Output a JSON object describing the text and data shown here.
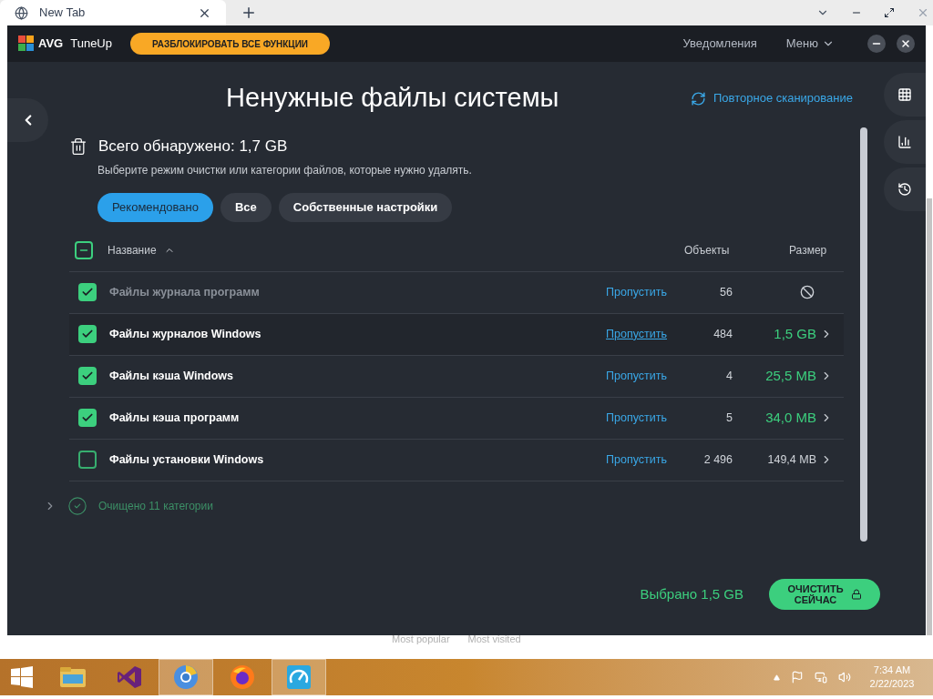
{
  "browser": {
    "tab": {
      "title": "New Tab"
    },
    "below_window": [
      "Most popular",
      "Most visited"
    ]
  },
  "app": {
    "logo": "AVG",
    "product": "TuneUp",
    "unlock_button": "РАЗБЛОКИРОВАТЬ ВСЕ ФУНКЦИИ",
    "notifications": "Уведомления",
    "menu": "Меню"
  },
  "page": {
    "title": "Ненужные файлы системы",
    "rescan": "Повторное сканирование",
    "total": "Всего обнаружено: 1,7 GB",
    "hint": "Выберите режим очистки или категории файлов, которые нужно удалять.",
    "filters": [
      {
        "label": "Рекомендовано",
        "selected": true
      },
      {
        "label": "Все",
        "selected": false
      },
      {
        "label": "Собственные настройки",
        "selected": false
      }
    ],
    "table": {
      "select_all": {
        "indeterminate": true
      },
      "columns": [
        "Название",
        "Объекты",
        "Размер"
      ],
      "rows": [
        {
          "name": "Файлы журнала программ",
          "checked": true,
          "disabled": true,
          "hovered": false,
          "skip": "Пропустить",
          "count": "56"
        },
        {
          "name": "Файлы журналов Windows",
          "checked": true,
          "disabled": false,
          "hovered": true,
          "skip": "Пропустить",
          "count": "484",
          "size": "1,5 GB"
        },
        {
          "name": "Файлы кэша Windows",
          "checked": true,
          "disabled": false,
          "hovered": false,
          "skip": "Пропустить",
          "count": "4",
          "size": "25,5 MB"
        },
        {
          "name": "Файлы кэша программ",
          "checked": true,
          "disabled": false,
          "hovered": false,
          "skip": "Пропустить",
          "count": "5",
          "size": "34,0 MB"
        },
        {
          "name": "Файлы установки Windows",
          "checked": false,
          "disabled": false,
          "hovered": false,
          "skip": "Пропустить",
          "count": "2 496",
          "size": "149,4 MB"
        }
      ]
    },
    "cleaned": {
      "label": "Очищено 11 категории",
      "expanded": false
    },
    "selected_total": "Выбрано 1,5 GB",
    "clean_button": [
      "ОЧИСТИТЬ",
      "СЕЙЧАС"
    ]
  },
  "taskbar": {
    "apps": [
      {
        "kind": "explorer",
        "active": false
      },
      {
        "kind": "studio",
        "active": false
      },
      {
        "kind": "chrome",
        "active": true
      },
      {
        "kind": "firefox",
        "active": false
      },
      {
        "kind": "tuneup",
        "active": true
      }
    ],
    "time": "7:34 AM",
    "date": "2/22/2023"
  }
}
